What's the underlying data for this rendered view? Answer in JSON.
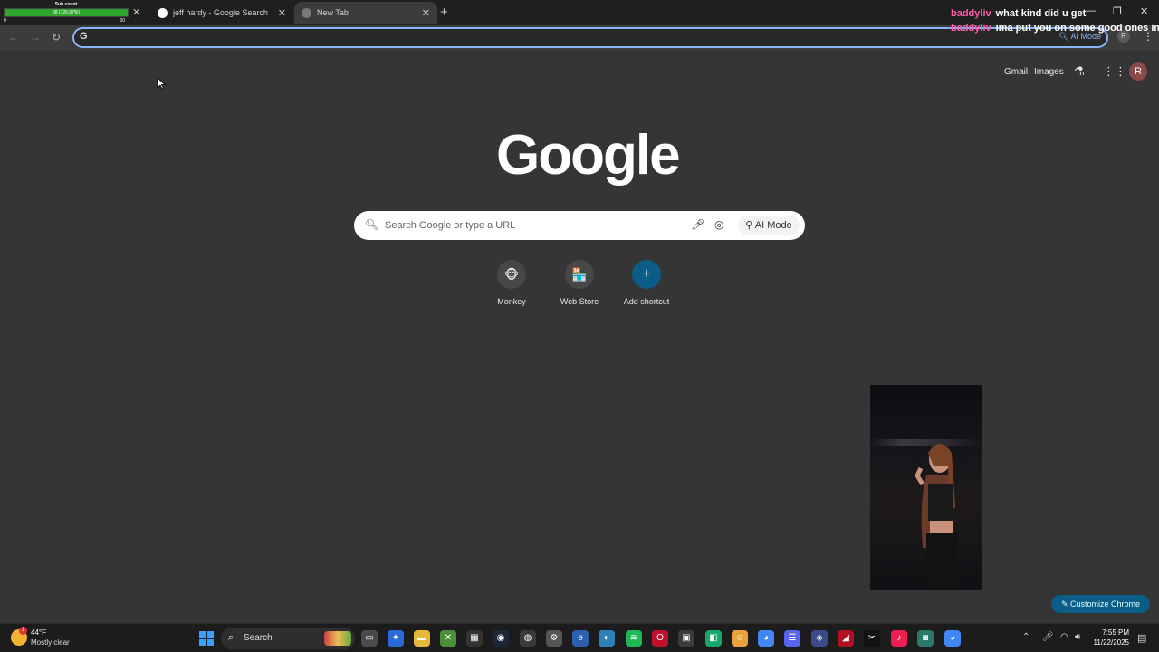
{
  "stream_overlay": {
    "sub_title": "Sub count",
    "sub_progress_text": "38 (126.67%)",
    "sub_progress": 1.0,
    "sub_low": "0",
    "sub_high": "30"
  },
  "tabs": [
    {
      "title": "jeff hardy - Google Search",
      "active": false
    },
    {
      "title": "New Tab",
      "active": true
    }
  ],
  "toolbar": {
    "omnibox_value": "",
    "omnibox_ai_label": "AI Mode",
    "profile_initial": "R"
  },
  "chat": [
    {
      "user": "baddyliv",
      "message": "what kind did u get"
    },
    {
      "user": "baddyliv",
      "message": "ima put you on some good ones im p"
    }
  ],
  "google_header": {
    "gmail": "Gmail",
    "images": "Images",
    "avatar_initial": "R"
  },
  "logo_text": "Google",
  "search": {
    "placeholder": "Search Google or type a URL",
    "ai_mode_label": "AI Mode"
  },
  "shortcuts": [
    {
      "label": "Monkey",
      "icon": "monkey-icon"
    },
    {
      "label": "Web Store",
      "icon": "web-store-icon"
    },
    {
      "label": "Add shortcut",
      "icon": "plus-icon"
    }
  ],
  "customize_label": "Customize Chrome",
  "taskbar": {
    "weather_temp": "44°F",
    "weather_desc": "Mostly clear",
    "weather_badge": "1",
    "search_label": "Search",
    "time": "7:55 PM",
    "date": "11/22/2025"
  },
  "colors": {
    "page_bg": "#353535",
    "accent_blue": "#8ab4f8",
    "chat_user": "#ff5aa8",
    "progress_green": "#2ea52e"
  }
}
